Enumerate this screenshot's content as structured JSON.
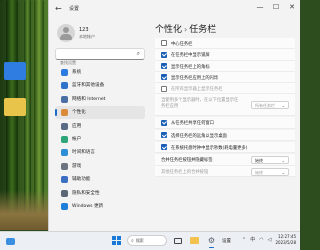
{
  "window": {
    "title": "设置",
    "back_glyph": "←",
    "controls": {
      "minimize": "—",
      "maximize": "☐",
      "close": "✕"
    }
  },
  "user": {
    "name": "123",
    "subtitle": "本地帐户"
  },
  "search": {
    "placeholder": "查找设置"
  },
  "sidebar": {
    "items": [
      {
        "label": "系统",
        "icon": "system-icon",
        "color": "#2d7be0"
      },
      {
        "label": "蓝牙和其他设备",
        "icon": "bluetooth-icon",
        "color": "#2f72c9"
      },
      {
        "label": "网络和 Internet",
        "icon": "network-icon",
        "color": "#4a6fa5"
      },
      {
        "label": "个性化",
        "icon": "brush-icon",
        "color": "#d98a3a",
        "active": true
      },
      {
        "label": "应用",
        "icon": "apps-icon",
        "color": "#5a6b86"
      },
      {
        "label": "帐户",
        "icon": "account-icon",
        "color": "#2fa67a"
      },
      {
        "label": "时间和语言",
        "icon": "clock-language-icon",
        "color": "#2b8fd6"
      },
      {
        "label": "游戏",
        "icon": "gamepad-icon",
        "color": "#6b7480"
      },
      {
        "label": "辅助功能",
        "icon": "accessibility-icon",
        "color": "#3b6fc2"
      },
      {
        "label": "隐私和安全性",
        "icon": "shield-icon",
        "color": "#5b6677"
      },
      {
        "label": "Windows 更新",
        "icon": "update-icon",
        "color": "#1f7fd8"
      }
    ]
  },
  "main": {
    "breadcrumb": {
      "parent": "个性化",
      "separator": "›",
      "current": "任务栏"
    },
    "rows": [
      {
        "label": "中心任务栏",
        "checked": false,
        "dim": false
      },
      {
        "label": "在任务栏中显示锁屏",
        "checked": true,
        "dim": false
      },
      {
        "label": "显示任务栏上的角标",
        "checked": true,
        "dim": false
      },
      {
        "label": "显示任务栏应用上的闪烁",
        "checked": true,
        "dim": false
      },
      {
        "label": "在所有显示器上显示任务栏",
        "checked": false,
        "dim": true
      },
      {
        "label": "当使用多个显示器时，在以下位置显示任务栏应用",
        "dropdown": "所有任务栏",
        "dim": true,
        "tall": true
      },
      {
        "label": "从任务栏共享任何窗口",
        "checked": true,
        "dim": false
      },
      {
        "label": "选择任务栏的远角以显示桌面",
        "checked": true,
        "dim": false
      },
      {
        "label": "在系统托盘时钟中显示秒数(耗电量更多)",
        "checked": true,
        "dim": false
      },
      {
        "label": "合并任务栏按钮并隐藏标签",
        "dropdown": "始终",
        "dim": false
      },
      {
        "label": "其他任务栏上的合并按钮",
        "dropdown": "始终",
        "dim": true
      }
    ]
  },
  "taskbar": {
    "search_label": "搜索",
    "open_app_label": "设置",
    "tray": {
      "lang": "中",
      "time": "12:27:45",
      "date": "2023/5/28"
    }
  }
}
